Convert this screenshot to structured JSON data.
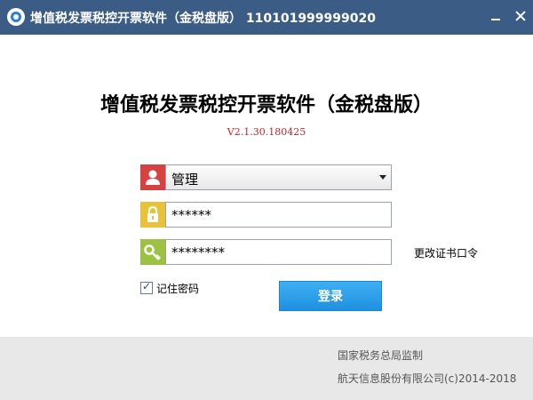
{
  "window": {
    "title": "增值税发票税控开票软件（金税盘版） 110101999999020"
  },
  "main": {
    "heading": "增值税发票税控开票软件（金税盘版）",
    "version": "V2.1.30.180425"
  },
  "login": {
    "user_value": "管理",
    "password_value": "******",
    "cert_password_value": "********",
    "change_cert_link": "更改证书口令",
    "remember_label": "记住密码",
    "remember_checked": true,
    "login_button": "登录"
  },
  "footer": {
    "line1": "国家税务总局监制",
    "line2": "航天信息股份有限公司(c)2014-2018"
  },
  "colors": {
    "titlebar": "#3b5c85",
    "user_icon": "#d64242",
    "lock_icon": "#e8c23b",
    "key_icon": "#9dc143",
    "login_button": "#2a9de8",
    "version_text": "#c0272d"
  },
  "icons": {
    "app_logo": "app-logo-icon",
    "user": "user-icon",
    "lock": "lock-icon",
    "key": "key-icon",
    "minimize": "minimize-icon",
    "close": "close-icon",
    "dropdown": "chevron-down-icon"
  }
}
